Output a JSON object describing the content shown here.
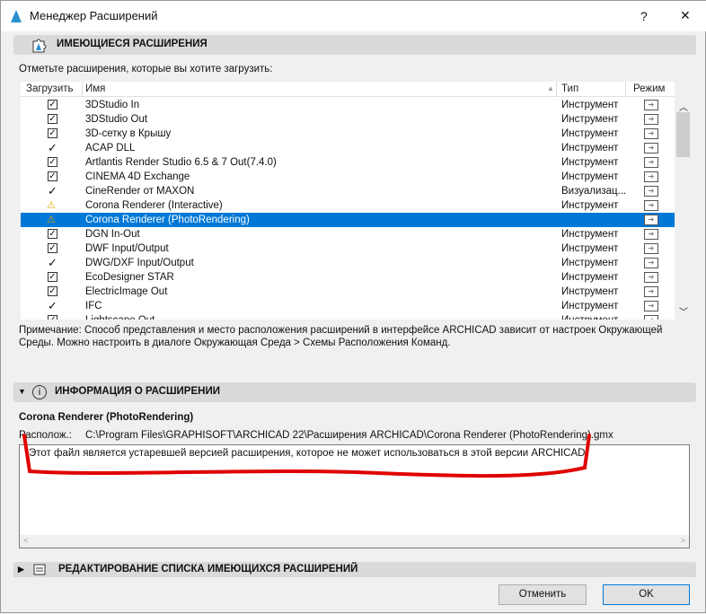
{
  "window": {
    "title": "Менеджер Расширений",
    "help": "?",
    "close": "✕"
  },
  "available": {
    "header": "ИМЕЮЩИЕСЯ РАСШИРЕНИЯ",
    "prompt": "Отметьте расширения, которые вы хотите загрузить:",
    "columns": {
      "load": "Загрузить",
      "name": "Имя",
      "type": "Тип",
      "mode": "Режим"
    },
    "rows": [
      {
        "state": "checkbox",
        "name": "3DStudio In",
        "type": "Инструмент"
      },
      {
        "state": "checkbox",
        "name": "3DStudio Out",
        "type": "Инструмент"
      },
      {
        "state": "checkbox",
        "name": "3D-сетку в Крышу",
        "type": "Инструмент"
      },
      {
        "state": "tick",
        "name": "ACAP DLL",
        "type": "Инструмент"
      },
      {
        "state": "checkbox",
        "name": "Artlantis Render Studio 6.5 & 7 Out(7.4.0)",
        "type": "Инструмент"
      },
      {
        "state": "checkbox",
        "name": "CINEMA 4D Exchange",
        "type": "Инструмент"
      },
      {
        "state": "tick",
        "name": "CineRender от MAXON",
        "type": "Визуализац..."
      },
      {
        "state": "warning",
        "name": "Corona Renderer (Interactive)",
        "type": "Инструмент"
      },
      {
        "state": "warning",
        "name": "Corona Renderer (PhotoRendering)",
        "type": "",
        "selected": true
      },
      {
        "state": "checkbox",
        "name": "DGN In-Out",
        "type": "Инструмент"
      },
      {
        "state": "checkbox",
        "name": "DWF Input/Output",
        "type": "Инструмент"
      },
      {
        "state": "tick",
        "name": "DWG/DXF Input/Output",
        "type": "Инструмент"
      },
      {
        "state": "checkbox",
        "name": "EcoDesigner STAR",
        "type": "Инструмент"
      },
      {
        "state": "checkbox",
        "name": "ElectricImage Out",
        "type": "Инструмент"
      },
      {
        "state": "tick",
        "name": "IFC",
        "type": "Инструмент"
      },
      {
        "state": "checkbox",
        "name": "Lightscape Out",
        "type": "Инструмент"
      }
    ],
    "note": "Примечание: Способ представления и место расположения расширений в интерфейсе ARCHICAD зависит от настроек Окружающей Среды. Можно настроить в диалоге Окружающая Среда > Схемы Расположения Команд."
  },
  "info": {
    "header": "ИНФОРМАЦИЯ О РАСШИРЕНИИ",
    "name": "Corona Renderer (PhotoRendering)",
    "location_label": "Располож.:",
    "location": "C:\\Program Files\\GRAPHISOFT\\ARCHICAD 22\\Расширения ARCHICAD\\Corona Renderer (PhotoRendering).gmx",
    "message": "Этот файл является устаревшей версией расширения, которое не может использоваться в этой версии ARCHICAD."
  },
  "edit": {
    "header": "РЕДАКТИРОВАНИЕ СПИСКА ИМЕЮЩИХСЯ РАСШИРЕНИЙ"
  },
  "buttons": {
    "cancel": "Отменить",
    "ok": "OK"
  }
}
